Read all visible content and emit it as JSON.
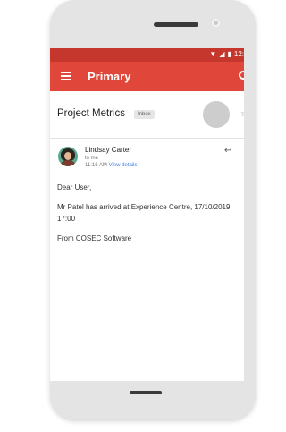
{
  "status_bar": {
    "time": "12:",
    "icons": [
      "wifi-icon",
      "signal-icon",
      "battery-icon"
    ]
  },
  "toolbar": {
    "title": "Primary",
    "menu_icon": "menu-icon",
    "search_icon": "search-icon"
  },
  "email": {
    "subject": "Project Metrics",
    "label": "Inbox",
    "sender_name": "Lindsay Carter",
    "recipient": "to me",
    "time": "11:16 AM",
    "view_details": "View details",
    "body": [
      "Dear User,",
      "Mr Patel has arrived at Experience Centre, 17/10/2019 17:00",
      "From COSEC Software"
    ]
  },
  "colors": {
    "status_bar": "#c5362d",
    "toolbar": "#e0463a",
    "link": "#3b78e7"
  }
}
